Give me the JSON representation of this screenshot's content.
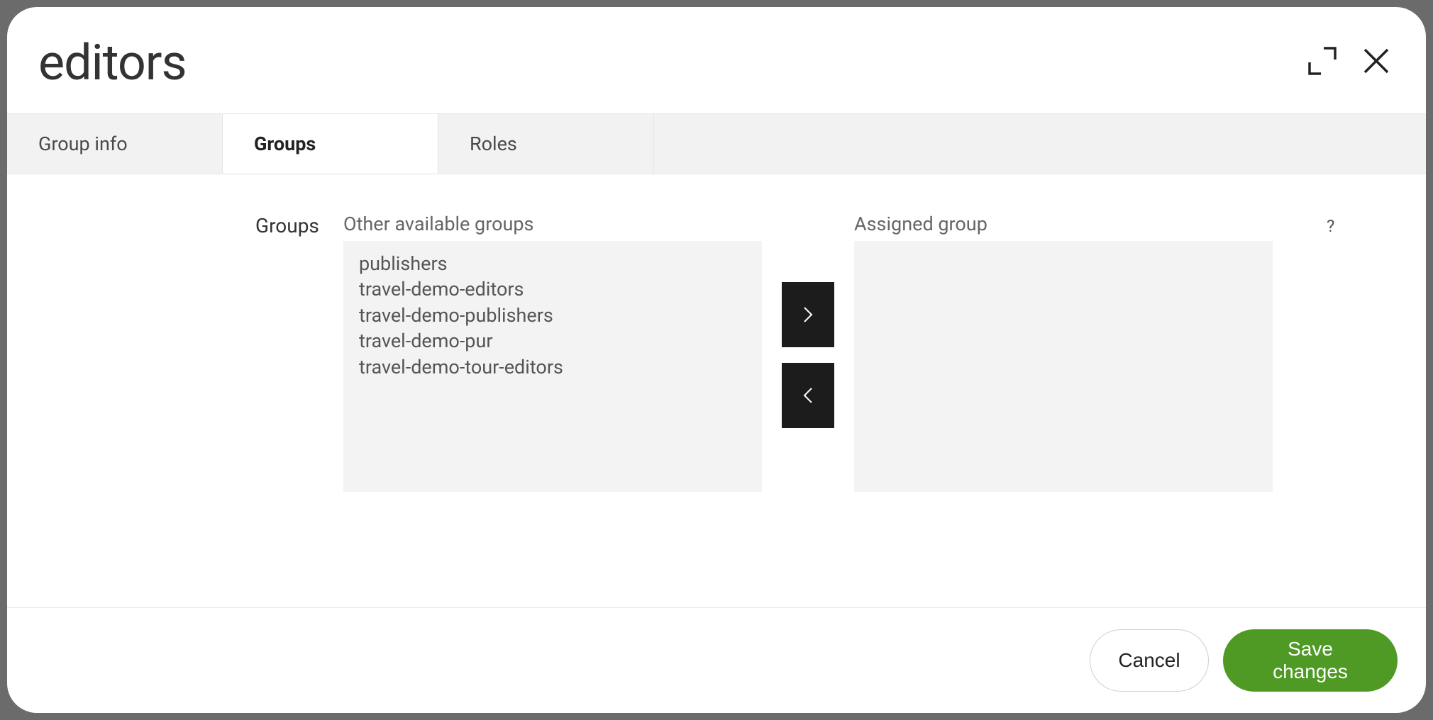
{
  "title": "editors",
  "tabs": [
    {
      "label": "Group info",
      "active": false
    },
    {
      "label": "Groups",
      "active": true
    },
    {
      "label": "Roles",
      "active": false
    }
  ],
  "section_label": "Groups",
  "available": {
    "label": "Other available groups",
    "items": [
      "publishers",
      "travel-demo-editors",
      "travel-demo-publishers",
      "travel-demo-pur",
      "travel-demo-tour-editors"
    ]
  },
  "assigned": {
    "label": "Assigned group",
    "items": []
  },
  "help_icon": "?",
  "buttons": {
    "cancel": "Cancel",
    "save": "Save changes"
  }
}
